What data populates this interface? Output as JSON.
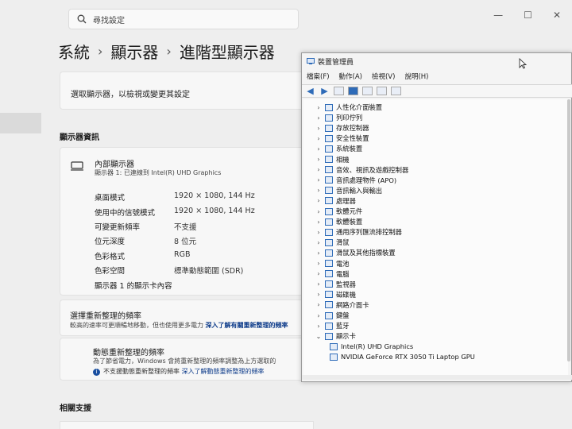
{
  "settings": {
    "search_placeholder": "尋找設定",
    "window_controls": [
      "—",
      "☐",
      "✕"
    ],
    "breadcrumb": [
      "系統",
      "顯示器",
      "進階型顯示器"
    ],
    "select_display_label": "選取顯示器，以檢視或變更其設定",
    "display_info_title": "顯示器資訊",
    "display": {
      "name": "內部顯示器",
      "subtitle": "顯示器 1: 已連線到 Intel(R) UHD Graphics"
    },
    "properties": [
      {
        "label": "桌面模式",
        "value": "1920 × 1080, 144 Hz"
      },
      {
        "label": "使用中的信號模式",
        "value": "1920 × 1080, 144 Hz"
      },
      {
        "label": "可變更新頻率",
        "value": "不支援"
      },
      {
        "label": "位元深度",
        "value": "8 位元"
      },
      {
        "label": "色彩格式",
        "value": "RGB"
      },
      {
        "label": "色彩空間",
        "value": "標準動態範圍 (SDR)"
      }
    ],
    "adapter_link": "顯示器 1 的顯示卡內容",
    "refresh": {
      "title": "選擇重新整理的頻率",
      "subtitle": "較高的速率可更順暢地移動，但也使用更多電力",
      "link": "深入了解有關重新整理的頻率"
    },
    "dynamic_refresh": {
      "title": "動態重新整理的頻率",
      "subtitle": "為了節省電力，Windows 會將重新整理的頻率調整為上方選取的",
      "note": "不支援動態重新整理的頻率",
      "link": "深入了解動態重新整理的頻率"
    },
    "related_title": "相關支援"
  },
  "device_manager": {
    "title": "裝置管理員",
    "menu": [
      "檔案(F)",
      "動作(A)",
      "檢視(V)",
      "說明(H)"
    ],
    "categories": [
      {
        "label": "人性化介面裝置",
        "icon": "hid-icon"
      },
      {
        "label": "列印佇列",
        "icon": "printer-icon"
      },
      {
        "label": "存放控制器",
        "icon": "storage-icon"
      },
      {
        "label": "安全性裝置",
        "icon": "security-icon"
      },
      {
        "label": "系統裝置",
        "icon": "system-folder-icon"
      },
      {
        "label": "相機",
        "icon": "camera-icon"
      },
      {
        "label": "音效、視訊及遊戲控制器",
        "icon": "speaker-icon"
      },
      {
        "label": "音訊處理物件 (APO)",
        "icon": "speaker-icon"
      },
      {
        "label": "音訊輸入與輸出",
        "icon": "speaker-icon"
      },
      {
        "label": "處理器",
        "icon": "cpu-icon"
      },
      {
        "label": "軟體元件",
        "icon": "component-icon"
      },
      {
        "label": "軟體裝置",
        "icon": "component-icon"
      },
      {
        "label": "通用序列匯流排控制器",
        "icon": "usb-icon"
      },
      {
        "label": "滑鼠",
        "icon": "mouse-icon"
      },
      {
        "label": "滑鼠及其他指標裝置",
        "icon": "mouse-icon"
      },
      {
        "label": "電池",
        "icon": "battery-icon"
      },
      {
        "label": "電腦",
        "icon": "computer-icon"
      },
      {
        "label": "監視器",
        "icon": "monitor-icon"
      },
      {
        "label": "磁碟機",
        "icon": "disk-icon"
      },
      {
        "label": "網路介面卡",
        "icon": "network-icon"
      },
      {
        "label": "鍵盤",
        "icon": "keyboard-icon"
      },
      {
        "label": "藍牙",
        "icon": "bluetooth-icon"
      }
    ],
    "expanded_category": {
      "label": "顯示卡",
      "icon": "display-adapter-icon"
    },
    "adapters": [
      "Intel(R) UHD Graphics",
      "NVIDIA GeForce RTX 3050 Ti Laptop GPU"
    ]
  },
  "colors": {
    "link": "#0d3b8a",
    "tree_icon": "#2e6bb8",
    "info_icon": "#1a4fa0"
  }
}
